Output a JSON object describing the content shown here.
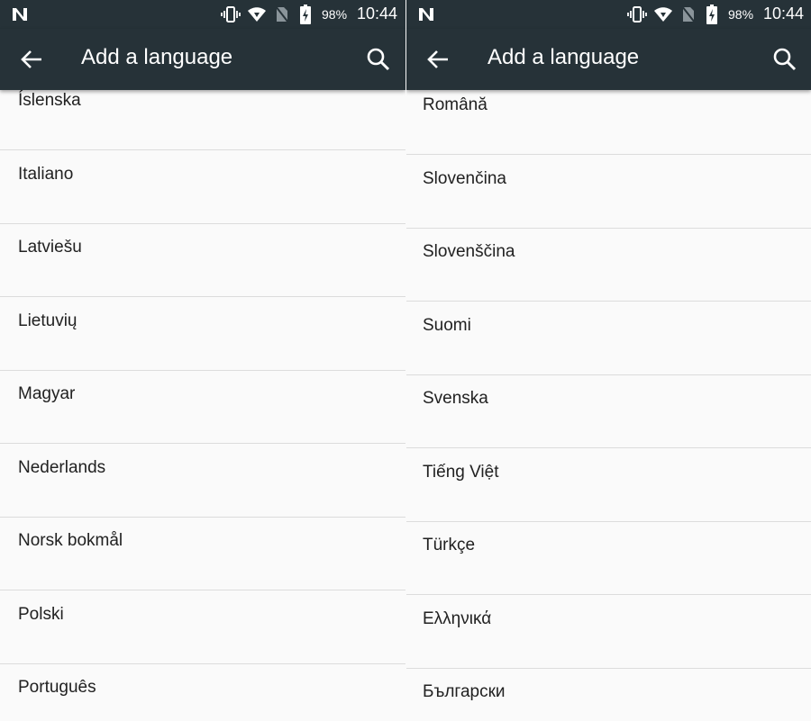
{
  "status": {
    "battery": "98%",
    "time": "10:44"
  },
  "toolbar": {
    "title": "Add a language"
  },
  "left_list": [
    "Íslenska",
    "Italiano",
    "Latviešu",
    "Lietuvių",
    "Magyar",
    "Nederlands",
    "Norsk bokmål",
    "Polski",
    "Português"
  ],
  "right_list": [
    "Română",
    "Slovenčina",
    "Slovenščina",
    "Suomi",
    "Svenska",
    "Tiếng Việt",
    "Türkçe",
    "Ελληνικά",
    "Български"
  ]
}
